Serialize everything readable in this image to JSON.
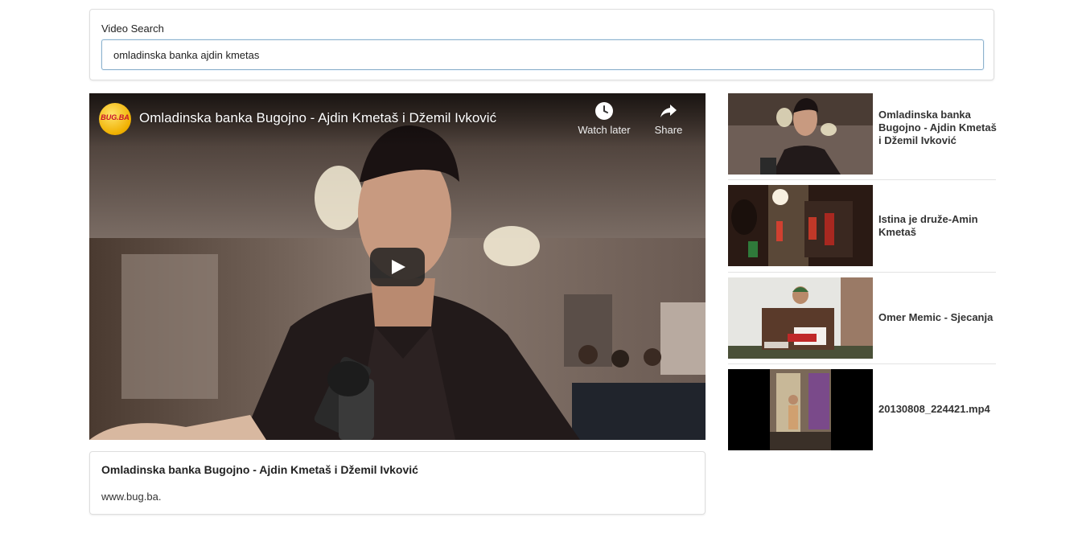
{
  "search": {
    "label": "Video Search",
    "value": "omladinska banka ajdin kmetas",
    "placeholder": ""
  },
  "player": {
    "channel_logo_text": "BUG.BA",
    "title": "Omladinska banka Bugojno - Ajdin Kmetaš i Džemil Ivković",
    "watch_later_label": "Watch later",
    "share_label": "Share",
    "icons": [
      "clock-icon",
      "share-arrow-icon",
      "play-icon"
    ]
  },
  "detail": {
    "title": "Omladinska banka Bugojno - Ajdin Kmetaš i Džemil Ivković",
    "description": "www.bug.ba."
  },
  "video_list": [
    {
      "title": "Omladinska banka Bugojno - Ajdin Kmetaš i Džemil Ivković"
    },
    {
      "title": "Istina je druže-Amin Kmetaš"
    },
    {
      "title": "Omer Memic - Sjecanja"
    },
    {
      "title": "20130808_224421.mp4"
    }
  ],
  "colors": {
    "input_border": "#8fb2cc",
    "card_border": "#dedede",
    "divider": "#e3e3e3",
    "logo_yellow": "#f0b000",
    "logo_red": "#c8102e"
  }
}
